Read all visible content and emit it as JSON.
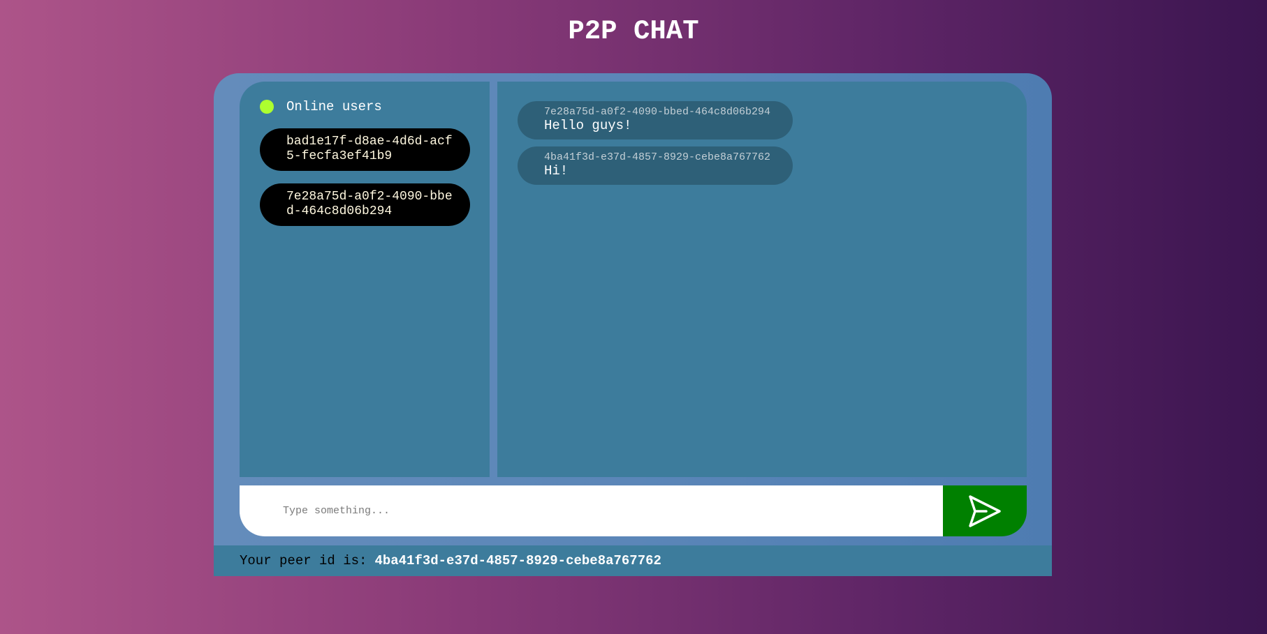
{
  "app": {
    "title": "P2P CHAT"
  },
  "sidebar": {
    "header_label": "Online users",
    "status_color": "#adff2f",
    "users": [
      {
        "id": "bad1e17f-d8ae-4d6d-acf5-fecfa3ef41b9"
      },
      {
        "id": "7e28a75d-a0f2-4090-bbed-464c8d06b294"
      }
    ]
  },
  "chat": {
    "messages": [
      {
        "sender": "7e28a75d-a0f2-4090-bbed-464c8d06b294",
        "text": "Hello guys!"
      },
      {
        "sender": "4ba41f3d-e37d-4857-8929-cebe8a767762",
        "text": "Hi!"
      }
    ]
  },
  "composer": {
    "placeholder": "Type something...",
    "value": "",
    "send_icon": "send-icon",
    "send_color": "#008000"
  },
  "footer": {
    "label": "Your peer id is:",
    "peer_id": "4ba41f3d-e37d-4857-8929-cebe8a767762"
  }
}
